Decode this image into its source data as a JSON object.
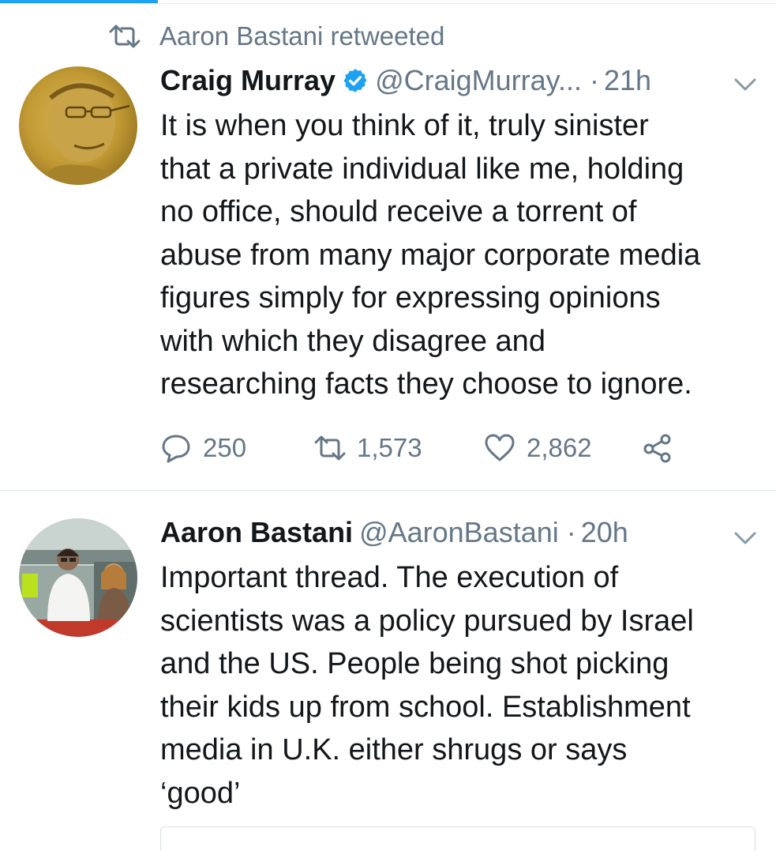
{
  "retweet_context": {
    "text": "Aaron Bastani retweeted",
    "icon": "retweet-icon"
  },
  "tweets": [
    {
      "name": "Craig Murray",
      "verified": true,
      "handle": "@CraigMurray...",
      "separator": "·",
      "time": "21h",
      "text": "It is when you think of it, truly sinister\nthat a private individual like me, holding\nno office, should receive a torrent of\nabuse from many major corporate media\nfigures simply for expressing opinions\nwith which they disagree and\nresearching facts they choose to ignore.",
      "actions": {
        "replies": "250",
        "retweets": "1,573",
        "likes": "2,862"
      }
    },
    {
      "name": "Aaron Bastani",
      "verified": false,
      "handle": "@AaronBastani",
      "separator": "·",
      "time": "20h",
      "text": "Important thread. The execution of\nscientists was a policy pursued by Israel\nand the US. People being shot picking\ntheir kids up from school. Establishment\nmedia in U.K. either shrugs or says\n‘good’"
    }
  ],
  "colors": {
    "accent": "#1da1f2",
    "muted": "#657786",
    "text": "#14171a",
    "divider": "#e1e8ed"
  }
}
